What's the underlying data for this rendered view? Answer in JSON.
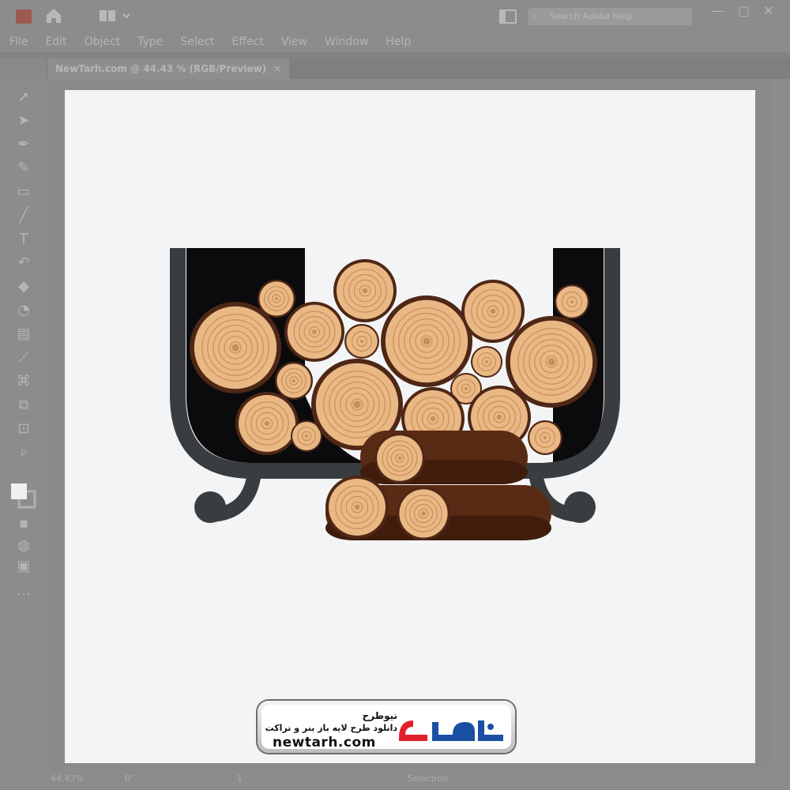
{
  "app": {
    "menu": [
      "File",
      "Edit",
      "Object",
      "Type",
      "Select",
      "Effect",
      "View",
      "Window",
      "Help"
    ],
    "search_placeholder": "Search Adobe Help",
    "tab_title": "NewTarh.com @ 44.43 % (RGB/Preview)",
    "tab_close": "×",
    "status": {
      "zoom": "44.43%",
      "rotation": "0°",
      "artboard": "1",
      "mode": "Selection"
    }
  },
  "icons": {
    "home": "home-icon",
    "arrange": "arrange-documents-icon",
    "search": "search-icon",
    "minimize": "minimize-icon",
    "restore": "restore-icon",
    "close": "close-icon"
  },
  "watermark": {
    "brand_fa": "نیوطرح",
    "tagline_fa": "دانلود طرح لایه باز بنر و تراکت",
    "url": "newtarh.com",
    "logo_text_fa": "نیوطرح"
  },
  "colors": {
    "basket": "#0b0b0d",
    "basket_rim": "#393d3f",
    "log_wood": "#e9b884",
    "log_bark": "#4e2716",
    "log_side": "#5a2b14",
    "logo_red": "#e4202a",
    "logo_blue": "#1a4fa3"
  }
}
